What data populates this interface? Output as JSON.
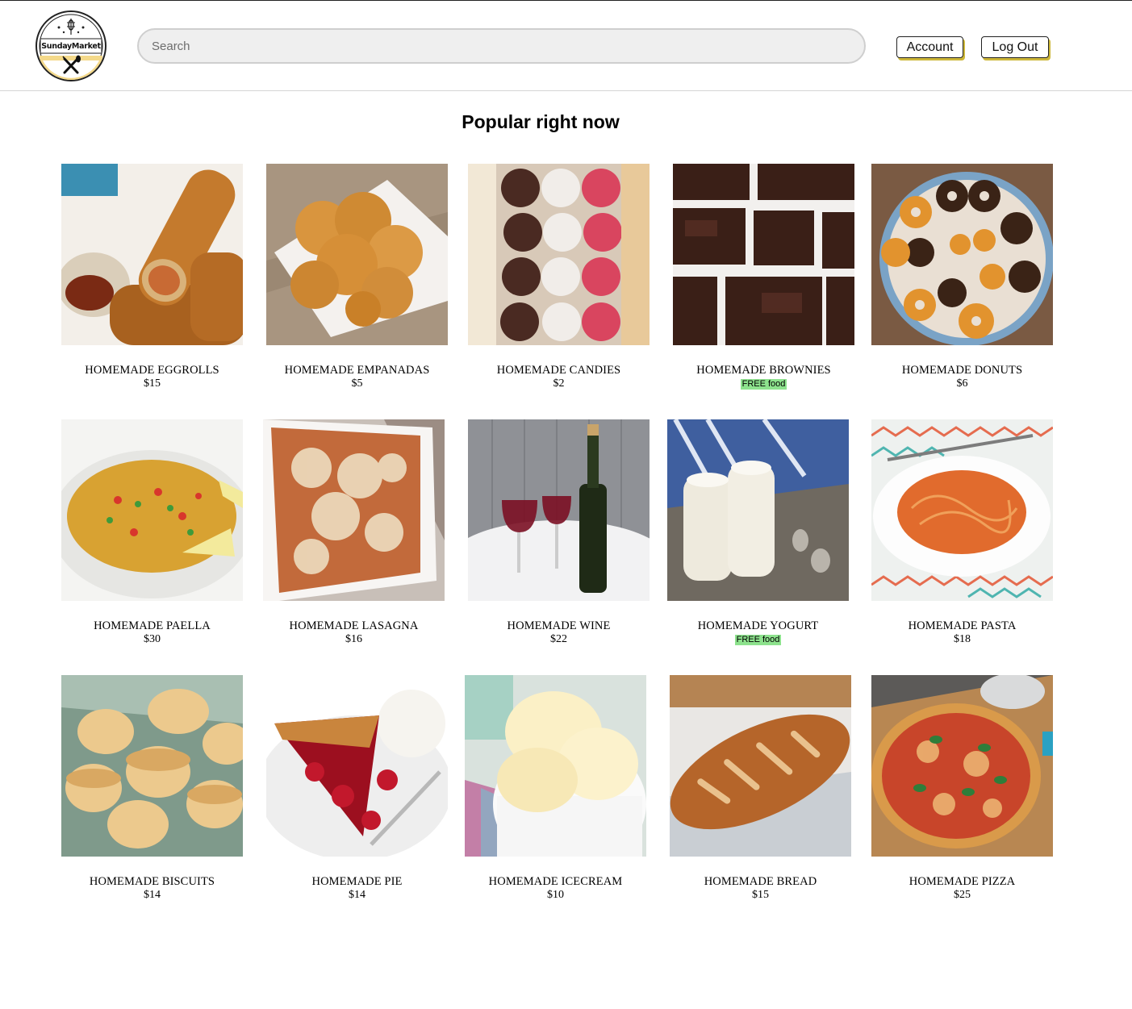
{
  "brand": {
    "logo_text": "SundayMarket"
  },
  "search": {
    "placeholder": "Search"
  },
  "header": {
    "account_label": "Account",
    "logout_label": "Log Out",
    "accent_color": "#cdb73a"
  },
  "section": {
    "title": "Popular right now"
  },
  "products": [
    {
      "name": "HOMEMADE EGGROLLS",
      "price": "$15",
      "free": false
    },
    {
      "name": "HOMEMADE EMPANADAS",
      "price": "$5",
      "free": false
    },
    {
      "name": "HOMEMADE CANDIES",
      "price": "$2",
      "free": false
    },
    {
      "name": "HOMEMADE BROWNIES",
      "price": "FREE food",
      "free": true
    },
    {
      "name": "HOMEMADE DONUTS",
      "price": "$6",
      "free": false
    },
    {
      "name": "HOMEMADE PAELLA",
      "price": "$30",
      "free": false
    },
    {
      "name": "HOMEMADE LASAGNA",
      "price": "$16",
      "free": false
    },
    {
      "name": "HOMEMADE WINE",
      "price": "$22",
      "free": false
    },
    {
      "name": "HOMEMADE YOGURT",
      "price": "FREE food",
      "free": true
    },
    {
      "name": "HOMEMADE PASTA",
      "price": "$18",
      "free": false
    },
    {
      "name": "HOMEMADE BISCUITS",
      "price": "$14",
      "free": false
    },
    {
      "name": "HOMEMADE PIE",
      "price": "$14",
      "free": false
    },
    {
      "name": "HOMEMADE ICECREAM",
      "price": "$10",
      "free": false
    },
    {
      "name": "HOMEMADE BREAD",
      "price": "$15",
      "free": false
    },
    {
      "name": "HOMEMADE PIZZA",
      "price": "$25",
      "free": false
    }
  ]
}
